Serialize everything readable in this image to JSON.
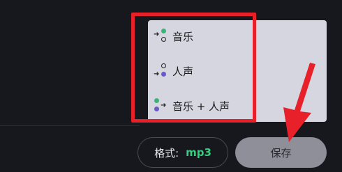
{
  "menu": {
    "items": [
      {
        "label": "音乐"
      },
      {
        "label": "人声"
      },
      {
        "label": "音乐 + 人声"
      }
    ]
  },
  "format": {
    "label": "格式:",
    "value": "mp3"
  },
  "save_label": "保存",
  "colors": {
    "background": "#17181d",
    "menu_background": "#d6d6e0",
    "music_dot": "#3db27a",
    "vocal_dot": "#6a5ac7",
    "format_value": "#35d07f",
    "save_button": "#8e8f99",
    "annotation_red": "#e8202a"
  }
}
